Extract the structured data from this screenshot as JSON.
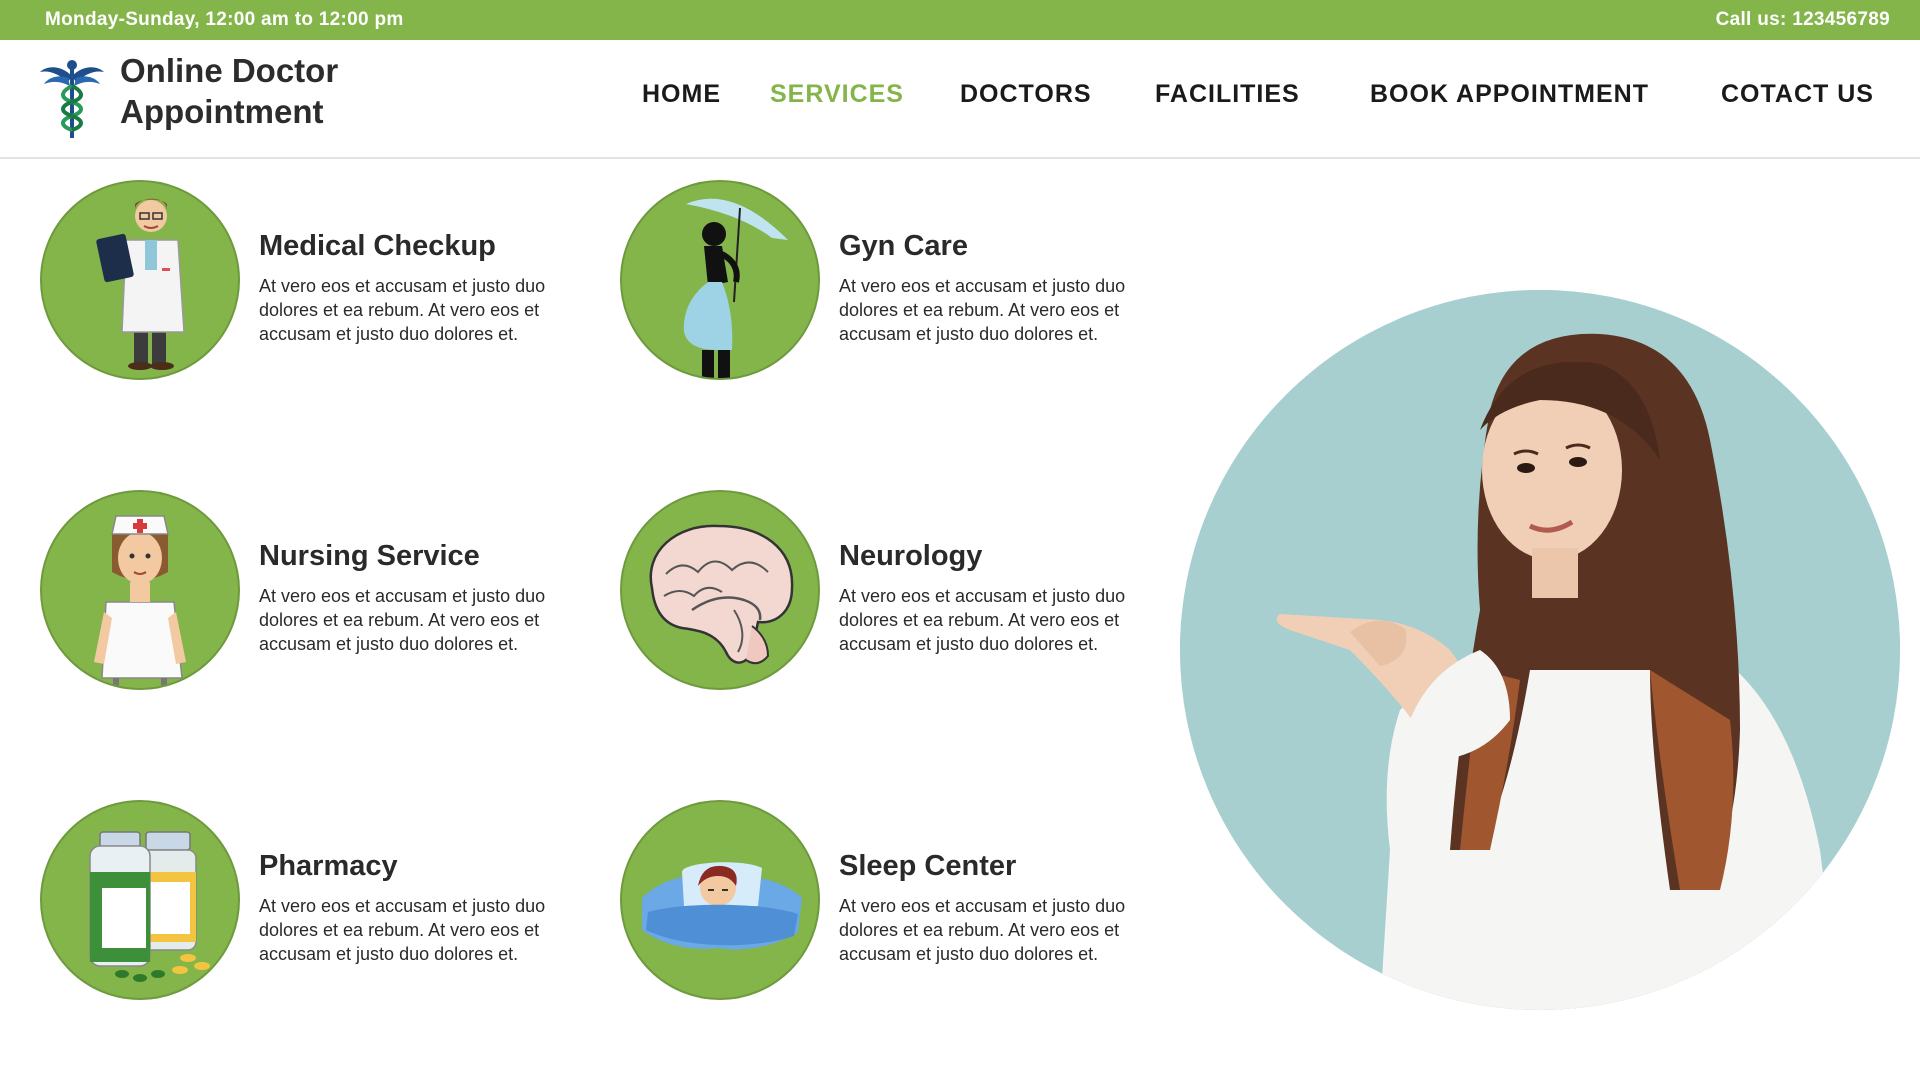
{
  "topbar": {
    "hours": "Monday-Sunday, 12:00 am to 12:00 pm",
    "phone": "Call us: 123456789"
  },
  "brand": {
    "line1": "Online Doctor",
    "line2": "Appointment",
    "icon": "caduceus-icon"
  },
  "nav": {
    "home": "HOME",
    "services": "SERVICES",
    "doctors": "DOCTORS",
    "facilities": "FACILITIES",
    "book": "BOOK  APPOINTMENT",
    "contact": "COTACT US"
  },
  "services": [
    {
      "title": "Medical Checkup",
      "text": "At vero eos et accusam et justo duo dolores et ea rebum. At vero eos et accusam et justo duo dolores et.",
      "icon": "doctor-icon"
    },
    {
      "title": "Gyn Care",
      "text": "At vero eos et accusam et justo duo dolores et ea rebum. At vero eos et accusam et justo duo dolores et.",
      "icon": "pregnant-woman-icon"
    },
    {
      "title": "Nursing Service",
      "text": "At vero eos et accusam et justo duo dolores et ea rebum. At vero eos et accusam et justo duo dolores et.",
      "icon": "nurse-icon"
    },
    {
      "title": "Neurology",
      "text": "At vero eos et accusam et justo duo dolores et ea rebum. At vero eos et accusam et justo duo dolores et.",
      "icon": "brain-icon"
    },
    {
      "title": "Pharmacy",
      "text": "At vero eos et accusam et justo duo dolores et ea rebum. At vero eos et accusam et justo duo dolores et.",
      "icon": "pill-bottles-icon"
    },
    {
      "title": "Sleep Center",
      "text": "At vero eos et accusam et justo duo dolores et ea rebum. At vero eos et accusam et justo duo dolores et.",
      "icon": "sleeping-person-icon"
    }
  ],
  "colors": {
    "accent": "#84b54a",
    "hero_bg": "#a7cfcf",
    "text": "#2a2a2a"
  }
}
